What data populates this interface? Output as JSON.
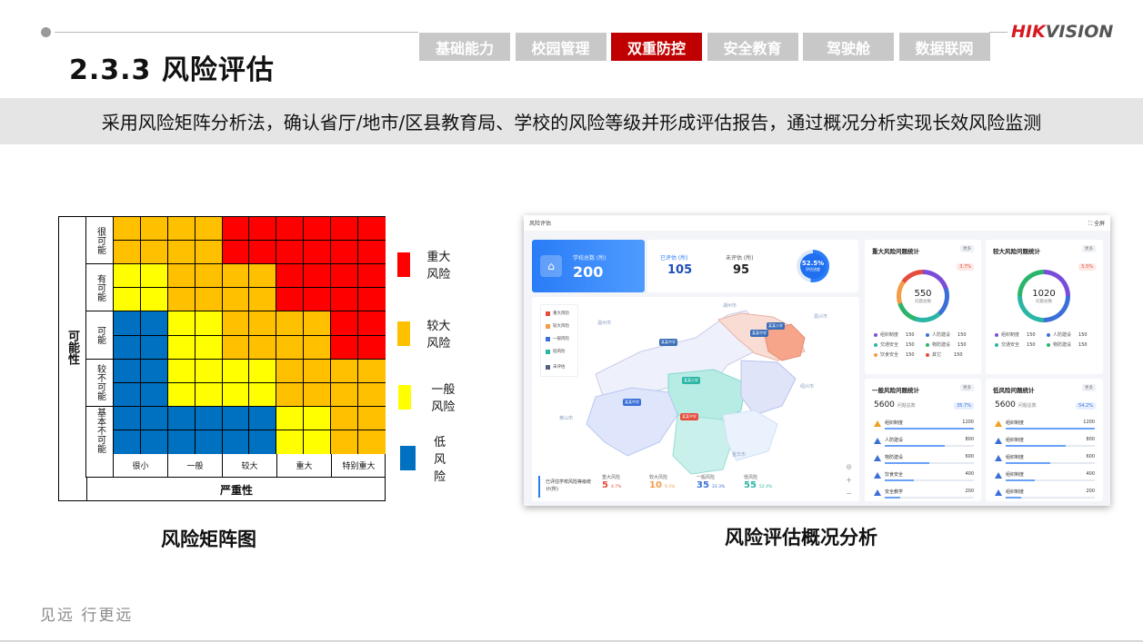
{
  "header": {
    "title": "2.3.3 风险评估",
    "tabs": [
      {
        "label": "基础能力",
        "active": false
      },
      {
        "label": "校园管理",
        "active": false
      },
      {
        "label": "双重防控",
        "active": true
      },
      {
        "label": "安全教育",
        "active": false
      },
      {
        "label": "驾驶舱",
        "active": false
      },
      {
        "label": "数据联网",
        "active": false
      }
    ],
    "brand_part1": "HIK",
    "brand_part2": "VISION"
  },
  "banner": {
    "text": "采用风险矩阵分析法，确认省厅/地市/区县教育局、学校的风险等级并形成评估报告，通过概况分析实现长效风险监测"
  },
  "matrix": {
    "y_axis_title": "可能性",
    "x_axis_title": "严重性",
    "y_labels": [
      "很可能",
      "有可能",
      "可能",
      "较不可能",
      "基本不可能"
    ],
    "x_labels": [
      "很小",
      "一般",
      "较大",
      "重大",
      "特别重大"
    ],
    "grid": [
      [
        "O",
        "O",
        "O",
        "O",
        "R",
        "R",
        "R",
        "R",
        "R",
        "R"
      ],
      [
        "O",
        "O",
        "O",
        "O",
        "R",
        "R",
        "R",
        "R",
        "R",
        "R"
      ],
      [
        "Y",
        "Y",
        "O",
        "O",
        "O",
        "O",
        "R",
        "R",
        "R",
        "R"
      ],
      [
        "Y",
        "Y",
        "O",
        "O",
        "O",
        "O",
        "R",
        "R",
        "R",
        "R"
      ],
      [
        "B",
        "B",
        "Y",
        "Y",
        "O",
        "O",
        "O",
        "O",
        "R",
        "R"
      ],
      [
        "B",
        "B",
        "Y",
        "Y",
        "O",
        "O",
        "O",
        "O",
        "R",
        "R"
      ],
      [
        "B",
        "B",
        "Y",
        "Y",
        "Y",
        "Y",
        "O",
        "O",
        "O",
        "O"
      ],
      [
        "B",
        "B",
        "Y",
        "Y",
        "Y",
        "Y",
        "O",
        "O",
        "O",
        "O"
      ],
      [
        "B",
        "B",
        "B",
        "B",
        "B",
        "B",
        "Y",
        "Y",
        "O",
        "O"
      ],
      [
        "B",
        "B",
        "B",
        "B",
        "B",
        "B",
        "Y",
        "Y",
        "O",
        "O"
      ]
    ],
    "colors": {
      "R": "#ff0000",
      "O": "#ffc000",
      "Y": "#ffff00",
      "B": "#0070c0"
    },
    "caption": "风险矩阵图"
  },
  "legend": [
    {
      "label": "重大风险",
      "color": "#ff0000"
    },
    {
      "label": "较大风险",
      "color": "#ffc000"
    },
    {
      "label": "一般风险",
      "color": "#ffff00"
    },
    {
      "label": "低风险",
      "color": "#0070c0"
    }
  ],
  "dashboard": {
    "window_title": "风险评估",
    "fullscreen_label": "全屏",
    "school_total_label": "学校总数 (所)",
    "school_total": "200",
    "evaluated_label": "已评估 (所)",
    "evaluated": "105",
    "not_evaluated_label": "未评估 (所)",
    "not_evaluated": "95",
    "eval_rate": "52.5%",
    "eval_rate_label": "评估进度",
    "eval_rate_value": 0.525,
    "map_legend": [
      {
        "label": "重大风险",
        "color": "#e64c3c"
      },
      {
        "label": "较大风险",
        "color": "#f39c4a"
      },
      {
        "label": "一般风险",
        "color": "#3b6fd8"
      },
      {
        "label": "低风险",
        "color": "#2bb5a5"
      },
      {
        "label": "未评估",
        "color": "#556080"
      }
    ],
    "cities": [
      "湖州市",
      "嘉兴市",
      "温州市",
      "绍兴市",
      "黄山市",
      "金华市"
    ],
    "pins": [
      "某某中学",
      "某某小学",
      "某某中学",
      "某某中学",
      "某某小学",
      "某某中学"
    ],
    "stat_strip": {
      "label": "已评估学校风险等级统计(所)",
      "items": [
        {
          "h": "重大风险",
          "n": "5",
          "p": "4.7%",
          "color": "#e64c3c"
        },
        {
          "h": "较大风险",
          "n": "10",
          "p": "9.5%",
          "color": "#f39c4a"
        },
        {
          "h": "一般风险",
          "n": "35",
          "p": "33.3%",
          "color": "#3b6fd8"
        },
        {
          "h": "低风险",
          "n": "55",
          "p": "52.4%",
          "color": "#2bb5a5"
        }
      ]
    },
    "major": {
      "title": "重大风险问题统计",
      "more": "更多",
      "pct": "3.7%",
      "total": "550",
      "total_label": "问题总数",
      "items": [
        {
          "name": "组织制度",
          "val": "150",
          "color": "#7a4dd8"
        },
        {
          "name": "人防建设",
          "val": "150",
          "color": "#3b6fd8"
        },
        {
          "name": "交通安全",
          "val": "150",
          "color": "#2bb5a5"
        },
        {
          "name": "物防建设",
          "val": "150",
          "color": "#2bb56a"
        },
        {
          "name": "饮食安全",
          "val": "150",
          "color": "#f39c4a"
        },
        {
          "name": "其它",
          "val": "150",
          "color": "#e64c3c"
        }
      ]
    },
    "large": {
      "title": "较大风险问题统计",
      "more": "更多",
      "pct": "5.5%",
      "total": "1020",
      "total_label": "问题总数",
      "items": [
        {
          "name": "组织制度",
          "val": "150",
          "color": "#7a4dd8"
        },
        {
          "name": "人防建设",
          "val": "150",
          "color": "#3b6fd8"
        },
        {
          "name": "交通安全",
          "val": "150",
          "color": "#2bb5a5"
        },
        {
          "name": "物防建设",
          "val": "150",
          "color": "#2bb56a"
        }
      ]
    },
    "general": {
      "title": "一般风险问题统计",
      "more": "更多",
      "total": "5600",
      "total_label": "问题总数",
      "pct": "35.7%",
      "rows": [
        {
          "name": "组织制度",
          "val": "1200",
          "fill": 1.0,
          "color": "#f0a020"
        },
        {
          "name": "人防建设",
          "val": "800",
          "fill": 0.67,
          "color": "#3b6fd8"
        },
        {
          "name": "物防建设",
          "val": "600",
          "fill": 0.5,
          "color": "#3b6fd8"
        },
        {
          "name": "饮食安全",
          "val": "400",
          "fill": 0.33,
          "color": "#3b6fd8"
        },
        {
          "name": "安全教学",
          "val": "200",
          "fill": 0.17,
          "color": "#3b6fd8"
        }
      ]
    },
    "low": {
      "title": "低风险问题统计",
      "more": "更多",
      "total": "5600",
      "total_label": "问题总数",
      "pct": "54.2%",
      "rows": [
        {
          "name": "组织制度",
          "val": "1200",
          "fill": 1.0,
          "color": "#f0a020"
        },
        {
          "name": "组织制度",
          "val": "800",
          "fill": 0.67,
          "color": "#3b6fd8"
        },
        {
          "name": "组织制度",
          "val": "600",
          "fill": 0.5,
          "color": "#3b6fd8"
        },
        {
          "name": "组织制度",
          "val": "400",
          "fill": 0.33,
          "color": "#3b6fd8"
        },
        {
          "name": "组织制度",
          "val": "200",
          "fill": 0.17,
          "color": "#3b6fd8"
        }
      ]
    },
    "caption": "风险评估概况分析"
  },
  "footer": {
    "slogan": "见远 行更远"
  }
}
